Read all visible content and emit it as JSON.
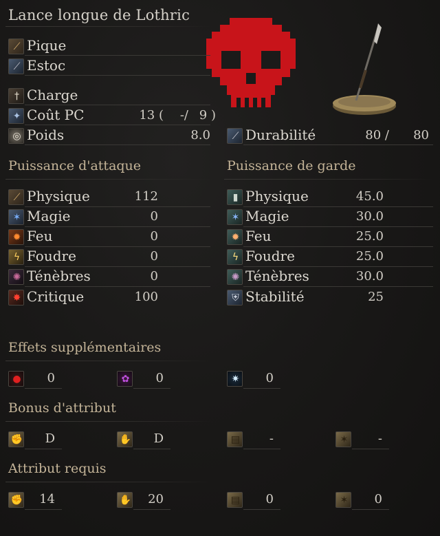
{
  "weapon_name": "Lance longue de Lothric",
  "attack_types": [
    "Pique",
    "Estoc"
  ],
  "skill": {
    "label": "Charge"
  },
  "fp_cost": {
    "label": "Coût PC",
    "value": "13 (",
    "mid": "-/",
    "max": "9 )"
  },
  "weight": {
    "label": "Poids",
    "value": "8.0"
  },
  "durability": {
    "label": "Durabilité",
    "current": "80 /",
    "max": "80"
  },
  "attack_power": {
    "title": "Puissance d'attaque",
    "rows": [
      {
        "label": "Physique",
        "value": "112"
      },
      {
        "label": "Magie",
        "value": "0"
      },
      {
        "label": "Feu",
        "value": "0"
      },
      {
        "label": "Foudre",
        "value": "0"
      },
      {
        "label": "Ténèbres",
        "value": "0"
      },
      {
        "label": "Critique",
        "value": "100"
      }
    ]
  },
  "guard_power": {
    "title": "Puissance de garde",
    "rows": [
      {
        "label": "Physique",
        "value": "45.0"
      },
      {
        "label": "Magie",
        "value": "30.0"
      },
      {
        "label": "Feu",
        "value": "25.0"
      },
      {
        "label": "Foudre",
        "value": "25.0"
      },
      {
        "label": "Ténèbres",
        "value": "30.0"
      },
      {
        "label": "Stabilité",
        "value": "25"
      }
    ]
  },
  "additional_effects": {
    "title": "Effets supplémentaires",
    "values": [
      "0",
      "0",
      "0"
    ]
  },
  "attribute_bonus": {
    "title": "Bonus d'attribut",
    "values": [
      "D",
      "D",
      "-",
      "-"
    ]
  },
  "attribute_required": {
    "title": "Attribut requis",
    "values": [
      "14",
      "20",
      "0",
      "0"
    ]
  },
  "icons": {
    "pique": "thrust-icon",
    "estoc": "pierce-icon",
    "charge": "skill-icon",
    "fp": "fp-icon",
    "weight": "weight-icon",
    "durability": "durability-icon",
    "skull": "red-skull-icon",
    "spear": "spear-item-icon"
  },
  "colors": {
    "section_title": "#c4b498",
    "skull": "#c8141a",
    "text": "#dcd8d0"
  }
}
